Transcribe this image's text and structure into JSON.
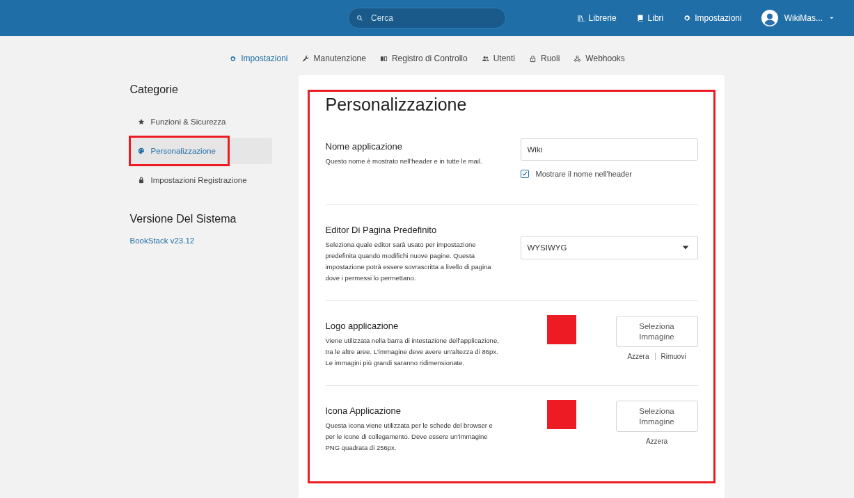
{
  "header": {
    "search": {
      "placeholder": "Cerca"
    },
    "links": [
      {
        "label": "Librerie"
      },
      {
        "label": "Libri"
      },
      {
        "label": "Impostazioni"
      }
    ],
    "user": {
      "name": "WikiMas..."
    }
  },
  "nav": [
    {
      "label": "Impostazioni",
      "selected": true
    },
    {
      "label": "Manutenzione",
      "selected": false
    },
    {
      "label": "Registro di Controllo",
      "selected": false
    },
    {
      "label": "Utenti",
      "selected": false
    },
    {
      "label": "Ruoli",
      "selected": false
    },
    {
      "label": "Webhooks",
      "selected": false
    }
  ],
  "sidebar": {
    "title": "Categorie",
    "items": [
      {
        "label": "Funzioni & Sicurezza",
        "selected": false,
        "highlighted": false
      },
      {
        "label": "Personalizzazione",
        "selected": true,
        "highlighted": true
      },
      {
        "label": "Impostazioni Registrazione",
        "selected": false,
        "highlighted": false
      }
    ],
    "version_title": "Versione Del Sistema",
    "version_link": "BookStack v23.12"
  },
  "card": {
    "title": "Personalizzazione",
    "highlighted": true,
    "sections": [
      {
        "kind": "text",
        "label": "Nome applicazione",
        "description": "Questo nome è mostrato nell'header e in tutte le mail.",
        "value": "Wiki",
        "checkbox": {
          "label": "Mostrare il nome nell'header",
          "checked": true
        }
      },
      {
        "kind": "select",
        "label": "Editor Di Pagina Predefinito",
        "description": "Seleziona quale editor sarà usato per impostazione predefinita quando modifichi nuove pagine. Questa impostazione potrà essere sovrascritta a livello di pagina dove i permessi lo permettano.",
        "value": "WYSIWYG"
      },
      {
        "kind": "image",
        "label": "Logo applicazione",
        "description": "Viene utilizzata nella barra di intestazione dell'applicazione, tra le altre aree. L'immagine deve avere un'altezza di 86px. Le immagini più grandi saranno ridimensionate.",
        "button": "Seleziona Immagine",
        "links": [
          "Azzera",
          "Rimuovi"
        ]
      },
      {
        "kind": "image",
        "label": "Icona Applicazione",
        "description": "Questa icona viene utilizzata per le schede del browser e per le icone di collegamento. Deve essere un'immagine PNG quadrata di 256px.",
        "button": "Seleziona Immagine",
        "links": [
          "Azzera"
        ]
      }
    ]
  }
}
